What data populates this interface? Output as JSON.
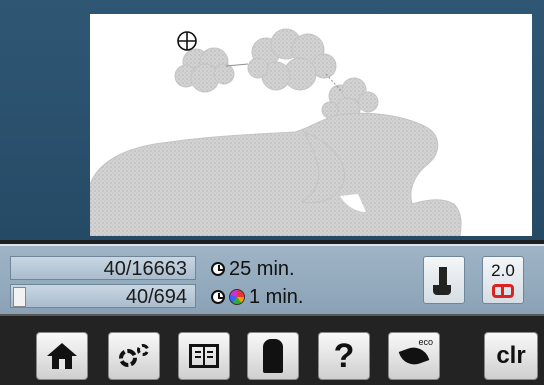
{
  "counters": {
    "total_stitches": "40/16663",
    "color_stitches": "40/694",
    "color_progress_fraction": 0.06
  },
  "times": {
    "total_time": "25 min.",
    "color_time": "1 min."
  },
  "needle": {
    "value": "2.0"
  },
  "nav": {
    "clr_label": "clr",
    "help_label": "?",
    "eco_label": "eco"
  },
  "icons": {
    "crosshair": "crosshair-icon",
    "clock": "clock-icon",
    "palette": "color-palette-icon",
    "presser_foot": "presser-foot-icon",
    "needle_position": "needle-position-icon",
    "home": "home-icon",
    "settings": "gears-icon",
    "book": "open-book-icon",
    "dress": "dress-form-icon",
    "help": "question-mark-icon",
    "eco": "eco-leaf-icon"
  },
  "colors": {
    "accent_red": "#dd2222",
    "panel_blue": "#9fb4c6",
    "screen_blue": "#2f5774"
  }
}
